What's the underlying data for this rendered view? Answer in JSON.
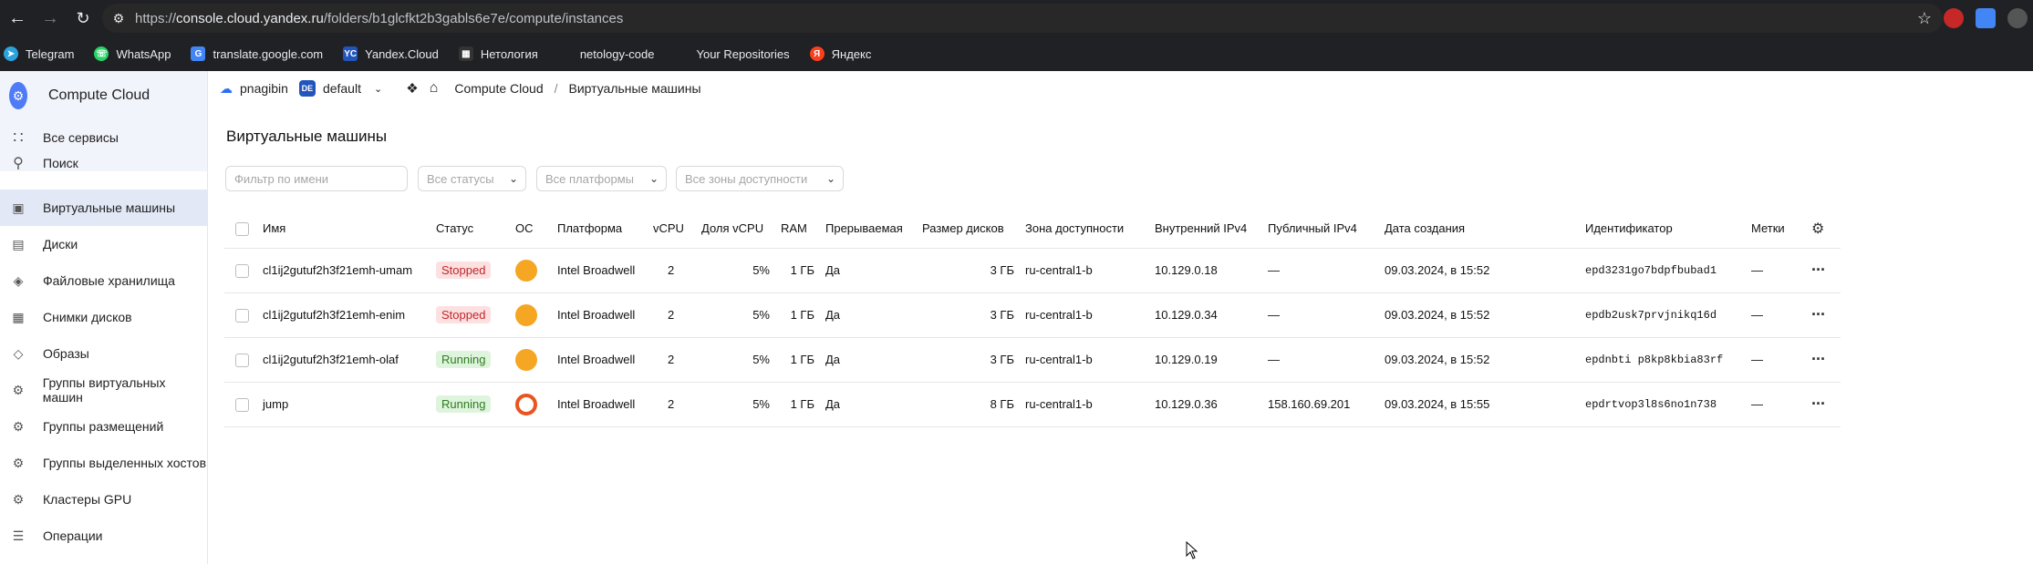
{
  "browser": {
    "url_prefix": "https://",
    "url_domain": "console.cloud.yandex.ru",
    "url_path": "/folders/b1glcfkt2b3gabls6e7e/compute/instances",
    "bookmarks": [
      {
        "label": "Telegram",
        "icon": "telegram-icon",
        "color": "#2aa3df"
      },
      {
        "label": "WhatsApp",
        "icon": "whatsapp-icon",
        "color": "#25d366"
      },
      {
        "label": "translate.google.com",
        "icon": "translate-icon",
        "color": "#4285f4"
      },
      {
        "label": "Yandex.Cloud",
        "icon": "yandex-cloud-icon",
        "color": "#2255bb"
      },
      {
        "label": "Нетология",
        "icon": "netology-icon",
        "color": "#333333"
      },
      {
        "label": "netology-code",
        "icon": "github-icon",
        "color": "#202124"
      },
      {
        "label": "Your Repositories",
        "icon": "github-icon",
        "color": "#202124"
      },
      {
        "label": "Яндекс",
        "icon": "yandex-icon",
        "color": "#fc3f1d"
      }
    ]
  },
  "sidebar": {
    "brand": "Compute Cloud",
    "top_items": [
      {
        "label": "Все сервисы",
        "icon": "grid-icon"
      },
      {
        "label": "Поиск",
        "icon": "search-icon"
      }
    ],
    "items": [
      {
        "label": "Виртуальные машины",
        "icon": "vm-icon",
        "active": true
      },
      {
        "label": "Диски",
        "icon": "disk-icon"
      },
      {
        "label": "Файловые хранилища",
        "icon": "file-storage-icon"
      },
      {
        "label": "Снимки дисков",
        "icon": "snapshot-icon"
      },
      {
        "label": "Образы",
        "icon": "image-icon"
      },
      {
        "label": "Группы виртуальных машин",
        "icon": "instance-group-icon"
      },
      {
        "label": "Группы размещений",
        "icon": "placement-group-icon"
      },
      {
        "label": "Группы выделенных хостов",
        "icon": "host-group-icon"
      },
      {
        "label": "Кластеры GPU",
        "icon": "gpu-cluster-icon"
      },
      {
        "label": "Операции",
        "icon": "operations-icon"
      }
    ]
  },
  "topnav": {
    "cloud": "pnagibin",
    "folder_badge": "DE",
    "folder": "default",
    "crumb_service": "Compute Cloud",
    "separator": "/",
    "crumb_page": "Виртуальные машины"
  },
  "page": {
    "title": "Виртуальные машины",
    "filter_placeholder": "Фильтр по имени",
    "status_select": "Все статусы",
    "platform_select": "Все платформы",
    "zone_select": "Все зоны доступности"
  },
  "table": {
    "headers": {
      "name": "Имя",
      "status": "Статус",
      "os": "ОС",
      "platform": "Платформа",
      "vcpu": "vCPU",
      "vcpu_share": "Доля vCPU",
      "ram": "RAM",
      "preemptible": "Прерываемая",
      "disk": "Размер дисков",
      "zone": "Зона доступности",
      "internal_ip": "Внутренний IPv4",
      "public_ip": "Публичный IPv4",
      "created": "Дата создания",
      "id": "Идентификатор",
      "labels": "Метки"
    },
    "rows": [
      {
        "name": "cl1ij2gutuf2h3f21emh-umam",
        "status": "Stopped",
        "os_icon": "lamp-icon",
        "platform": "Intel Broadwell",
        "vcpu": "2",
        "vcpu_share": "5%",
        "ram": "1 ГБ",
        "preemptible": "Да",
        "disk": "3 ГБ",
        "zone": "ru-central1-b",
        "internal_ip": "10.129.0.18",
        "public_ip": "—",
        "created": "09.03.2024, в 15:52",
        "id": "epd3231go7bdpfbubad1",
        "labels": "—"
      },
      {
        "name": "cl1ij2gutuf2h3f21emh-enim",
        "status": "Stopped",
        "os_icon": "lamp-icon",
        "platform": "Intel Broadwell",
        "vcpu": "2",
        "vcpu_share": "5%",
        "ram": "1 ГБ",
        "preemptible": "Да",
        "disk": "3 ГБ",
        "zone": "ru-central1-b",
        "internal_ip": "10.129.0.34",
        "public_ip": "—",
        "created": "09.03.2024, в 15:52",
        "id": "epdb2usk7prvjnikq16d",
        "labels": "—"
      },
      {
        "name": "cl1ij2gutuf2h3f21emh-olaf",
        "status": "Running",
        "os_icon": "lamp-icon",
        "platform": "Intel Broadwell",
        "vcpu": "2",
        "vcpu_share": "5%",
        "ram": "1 ГБ",
        "preemptible": "Да",
        "disk": "3 ГБ",
        "zone": "ru-central1-b",
        "internal_ip": "10.129.0.19",
        "public_ip": "—",
        "created": "09.03.2024, в 15:52",
        "id": "epdnbti p8kp8kbia83rf",
        "labels": "—"
      },
      {
        "name": "jump",
        "status": "Running",
        "os_icon": "ubuntu-icon",
        "platform": "Intel Broadwell",
        "vcpu": "2",
        "vcpu_share": "5%",
        "ram": "1 ГБ",
        "preemptible": "Да",
        "disk": "8 ГБ",
        "zone": "ru-central1-b",
        "internal_ip": "10.129.0.36",
        "public_ip": "158.160.69.201",
        "created": "09.03.2024, в 15:55",
        "id": "epdrtvop3l8s6no1n738",
        "labels": "—"
      }
    ]
  },
  "colors": {
    "accent": "#2b6ff5",
    "stopped_bg": "#fde0e0",
    "running_bg": "#dff4dd",
    "lamp": "#f5a623",
    "ubuntu": "#e95420"
  }
}
